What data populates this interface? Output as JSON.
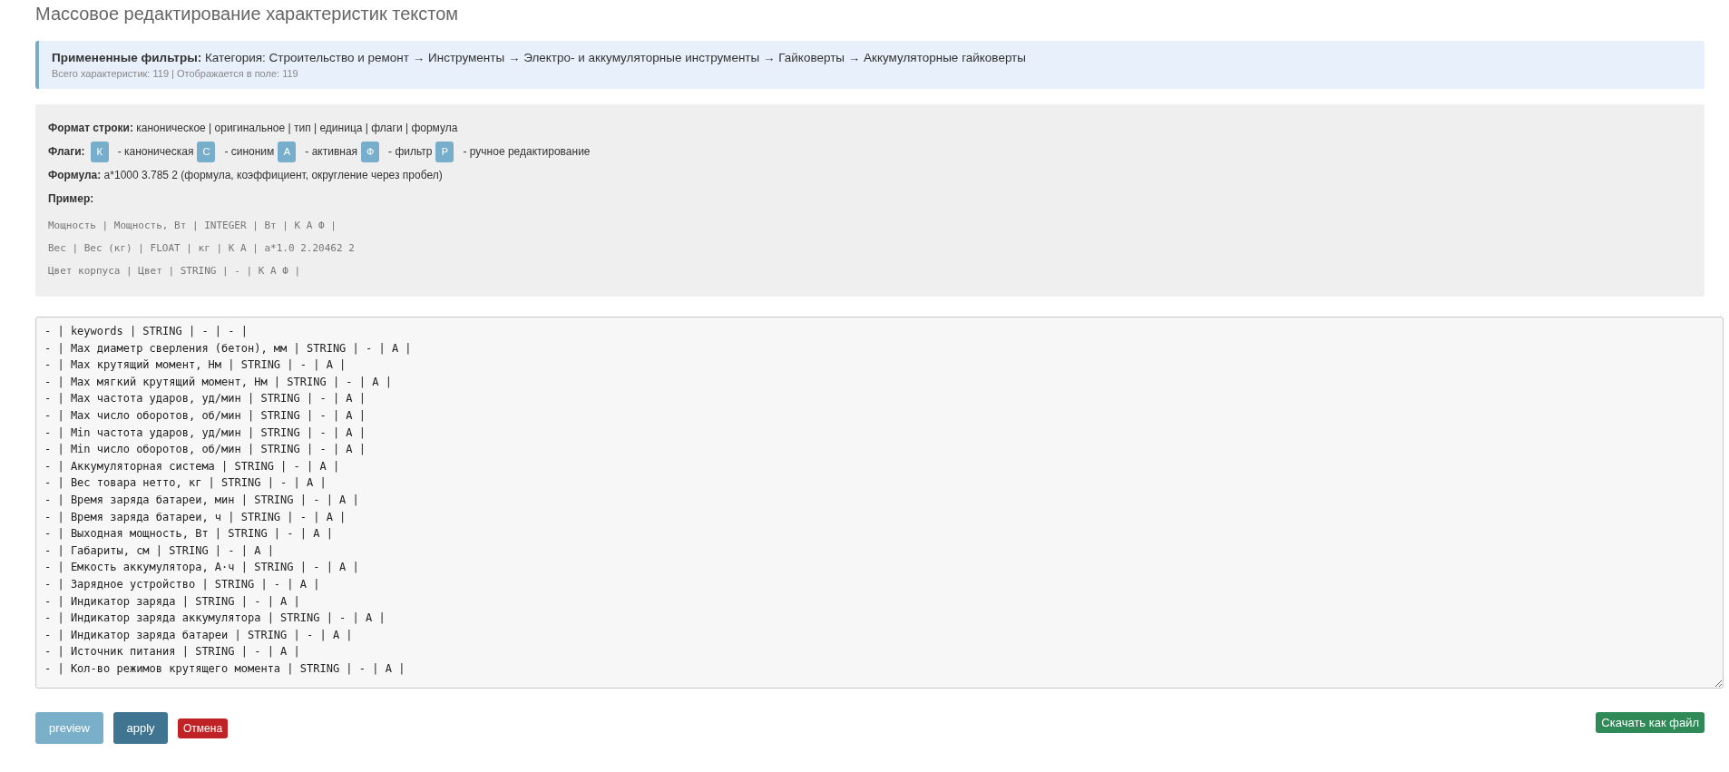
{
  "page": {
    "title": "Массовое редактирование характеристик текстом"
  },
  "filters": {
    "applied": "**Примененные фильтры:** Категория: Строительство и ремонт → Инструменты → Электро- и аккумуляторные инструменты → Гайковерты → Аккумуляторные гайковерты",
    "summary": "Всего характеристик: 119 | Отображается в поле: 119"
  },
  "format_help": {
    "row_format": "**Формат строки:** каноническое | оригинальное | тип | единица | флаги | формула",
    "flags_label": "Флаги:",
    "flags": [
      {
        "badge": "К",
        "description": "- каноническая"
      },
      {
        "badge": "С",
        "description": "- синоним"
      },
      {
        "badge": "А",
        "description": "- активная"
      },
      {
        "badge": "Ф",
        "description": "- фильтр"
      },
      {
        "badge": "Р",
        "description": "- ручное редактирование"
      }
    ],
    "formula": "**Формула:** a*1000 3.785 2 (формула, коэффициент, округление через пробел)",
    "example_label": "Пример:",
    "examples": [
      "Мощность | Мощность, Вт | INTEGER | Вт | К А Ф |",
      "Вес | Вес (кг) | FLOAT | кг | К А | a*1.0 2.20462 2",
      "Цвет корпуса | Цвет | STRING | - | К А Ф |"
    ]
  },
  "editor": {
    "lines": [
      "- | keywords | STRING | - | - |",
      "- | Max диаметр сверления (бетон), мм | STRING | - | А |",
      "- | Max крутящий момент, Нм | STRING | - | А |",
      "- | Max мягкий крутящий момент, Нм | STRING | - | А |",
      "- | Max частота ударов, уд/мин | STRING | - | А |",
      "- | Max число оборотов, об/мин | STRING | - | А |",
      "- | Min частота ударов, уд/мин | STRING | - | А |",
      "- | Min число оборотов, об/мин | STRING | - | А |",
      "- | Аккумуляторная система | STRING | - | А |",
      "- | Вес товара нетто, кг | STRING | - | А |",
      "- | Время заряда батареи, мин | STRING | - | А |",
      "- | Время заряда батареи, ч | STRING | - | А |",
      "- | Выходная мощность, Вт | STRING | - | А |",
      "- | Габариты, см | STRING | - | А |",
      "- | Емкость аккумулятора, А·ч | STRING | - | А |",
      "- | Зарядное устройство | STRING | - | А |",
      "- | Индикатор заряда | STRING | - | А |",
      "- | Индикатор заряда аккумулятора | STRING | - | А |",
      "- | Индикатор заряда батареи | STRING | - | А |",
      "- | Источник питания | STRING | - | А |",
      "- | Кол-во режимов крутящего момента | STRING | - | А |"
    ]
  },
  "actions": [
    {
      "label": "preview",
      "kind": "preview"
    },
    {
      "label": "apply",
      "kind": "apply"
    },
    {
      "label": "Отмена",
      "kind": "cancel"
    }
  ],
  "download_button": {
    "label": "Скачать как файл"
  }
}
